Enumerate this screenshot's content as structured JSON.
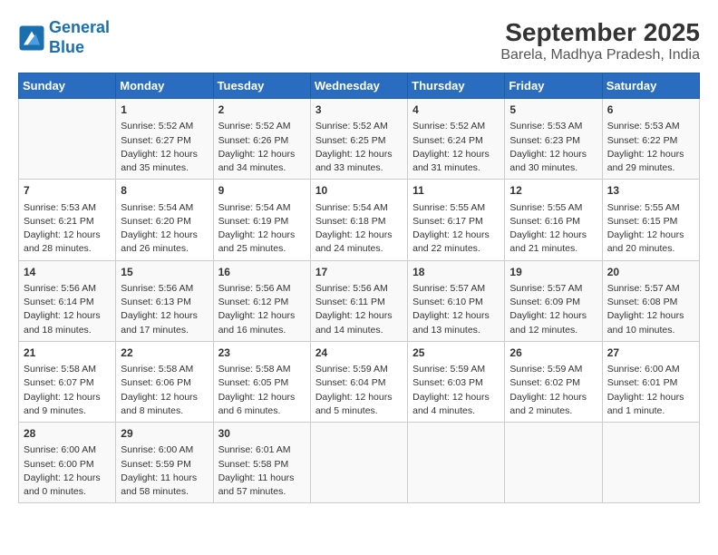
{
  "header": {
    "logo_line1": "General",
    "logo_line2": "Blue",
    "title": "September 2025",
    "subtitle": "Barela, Madhya Pradesh, India"
  },
  "days_of_week": [
    "Sunday",
    "Monday",
    "Tuesday",
    "Wednesday",
    "Thursday",
    "Friday",
    "Saturday"
  ],
  "weeks": [
    [
      {
        "day": "",
        "info": ""
      },
      {
        "day": "1",
        "info": "Sunrise: 5:52 AM\nSunset: 6:27 PM\nDaylight: 12 hours\nand 35 minutes."
      },
      {
        "day": "2",
        "info": "Sunrise: 5:52 AM\nSunset: 6:26 PM\nDaylight: 12 hours\nand 34 minutes."
      },
      {
        "day": "3",
        "info": "Sunrise: 5:52 AM\nSunset: 6:25 PM\nDaylight: 12 hours\nand 33 minutes."
      },
      {
        "day": "4",
        "info": "Sunrise: 5:52 AM\nSunset: 6:24 PM\nDaylight: 12 hours\nand 31 minutes."
      },
      {
        "day": "5",
        "info": "Sunrise: 5:53 AM\nSunset: 6:23 PM\nDaylight: 12 hours\nand 30 minutes."
      },
      {
        "day": "6",
        "info": "Sunrise: 5:53 AM\nSunset: 6:22 PM\nDaylight: 12 hours\nand 29 minutes."
      }
    ],
    [
      {
        "day": "7",
        "info": "Sunrise: 5:53 AM\nSunset: 6:21 PM\nDaylight: 12 hours\nand 28 minutes."
      },
      {
        "day": "8",
        "info": "Sunrise: 5:54 AM\nSunset: 6:20 PM\nDaylight: 12 hours\nand 26 minutes."
      },
      {
        "day": "9",
        "info": "Sunrise: 5:54 AM\nSunset: 6:19 PM\nDaylight: 12 hours\nand 25 minutes."
      },
      {
        "day": "10",
        "info": "Sunrise: 5:54 AM\nSunset: 6:18 PM\nDaylight: 12 hours\nand 24 minutes."
      },
      {
        "day": "11",
        "info": "Sunrise: 5:55 AM\nSunset: 6:17 PM\nDaylight: 12 hours\nand 22 minutes."
      },
      {
        "day": "12",
        "info": "Sunrise: 5:55 AM\nSunset: 6:16 PM\nDaylight: 12 hours\nand 21 minutes."
      },
      {
        "day": "13",
        "info": "Sunrise: 5:55 AM\nSunset: 6:15 PM\nDaylight: 12 hours\nand 20 minutes."
      }
    ],
    [
      {
        "day": "14",
        "info": "Sunrise: 5:56 AM\nSunset: 6:14 PM\nDaylight: 12 hours\nand 18 minutes."
      },
      {
        "day": "15",
        "info": "Sunrise: 5:56 AM\nSunset: 6:13 PM\nDaylight: 12 hours\nand 17 minutes."
      },
      {
        "day": "16",
        "info": "Sunrise: 5:56 AM\nSunset: 6:12 PM\nDaylight: 12 hours\nand 16 minutes."
      },
      {
        "day": "17",
        "info": "Sunrise: 5:56 AM\nSunset: 6:11 PM\nDaylight: 12 hours\nand 14 minutes."
      },
      {
        "day": "18",
        "info": "Sunrise: 5:57 AM\nSunset: 6:10 PM\nDaylight: 12 hours\nand 13 minutes."
      },
      {
        "day": "19",
        "info": "Sunrise: 5:57 AM\nSunset: 6:09 PM\nDaylight: 12 hours\nand 12 minutes."
      },
      {
        "day": "20",
        "info": "Sunrise: 5:57 AM\nSunset: 6:08 PM\nDaylight: 12 hours\nand 10 minutes."
      }
    ],
    [
      {
        "day": "21",
        "info": "Sunrise: 5:58 AM\nSunset: 6:07 PM\nDaylight: 12 hours\nand 9 minutes."
      },
      {
        "day": "22",
        "info": "Sunrise: 5:58 AM\nSunset: 6:06 PM\nDaylight: 12 hours\nand 8 minutes."
      },
      {
        "day": "23",
        "info": "Sunrise: 5:58 AM\nSunset: 6:05 PM\nDaylight: 12 hours\nand 6 minutes."
      },
      {
        "day": "24",
        "info": "Sunrise: 5:59 AM\nSunset: 6:04 PM\nDaylight: 12 hours\nand 5 minutes."
      },
      {
        "day": "25",
        "info": "Sunrise: 5:59 AM\nSunset: 6:03 PM\nDaylight: 12 hours\nand 4 minutes."
      },
      {
        "day": "26",
        "info": "Sunrise: 5:59 AM\nSunset: 6:02 PM\nDaylight: 12 hours\nand 2 minutes."
      },
      {
        "day": "27",
        "info": "Sunrise: 6:00 AM\nSunset: 6:01 PM\nDaylight: 12 hours\nand 1 minute."
      }
    ],
    [
      {
        "day": "28",
        "info": "Sunrise: 6:00 AM\nSunset: 6:00 PM\nDaylight: 12 hours\nand 0 minutes."
      },
      {
        "day": "29",
        "info": "Sunrise: 6:00 AM\nSunset: 5:59 PM\nDaylight: 11 hours\nand 58 minutes."
      },
      {
        "day": "30",
        "info": "Sunrise: 6:01 AM\nSunset: 5:58 PM\nDaylight: 11 hours\nand 57 minutes."
      },
      {
        "day": "",
        "info": ""
      },
      {
        "day": "",
        "info": ""
      },
      {
        "day": "",
        "info": ""
      },
      {
        "day": "",
        "info": ""
      }
    ]
  ]
}
